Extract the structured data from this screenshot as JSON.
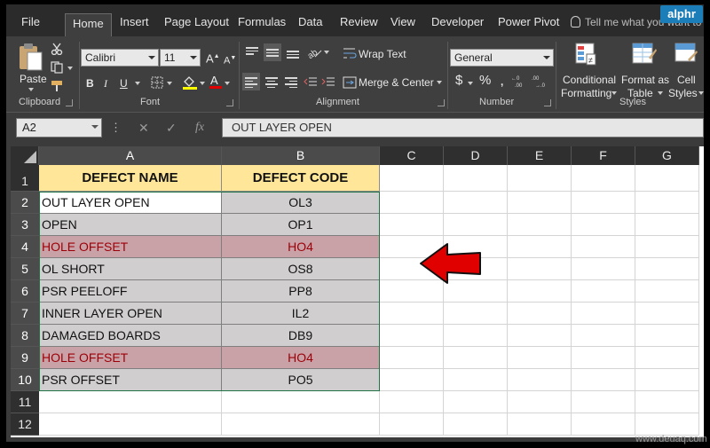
{
  "brand": "alphr",
  "tabs": [
    "File",
    "Home",
    "Insert",
    "Page Layout",
    "Formulas",
    "Data",
    "Review",
    "View",
    "Developer",
    "Power Pivot"
  ],
  "active_tab": "Home",
  "tell_me": "Tell me what you want to",
  "ribbon": {
    "clipboard": {
      "paste": "Paste",
      "label": "Clipboard"
    },
    "font": {
      "name": "Calibri",
      "size": "11",
      "bold": "B",
      "italic": "I",
      "underline": "U",
      "label": "Font"
    },
    "alignment": {
      "wrap_text": "Wrap Text",
      "merge_center": "Merge & Center",
      "label": "Alignment"
    },
    "number": {
      "format": "General",
      "currency": "$",
      "percent": "%",
      "label": "Number"
    },
    "styles": {
      "conditional_1": "Conditional",
      "conditional_2": "Formatting",
      "format_table_1": "Format as",
      "format_table_2": "Table",
      "cell_styles_1": "Cell",
      "cell_styles_2": "Styles",
      "label": "Styles"
    }
  },
  "formula_bar": {
    "name_box": "A2",
    "formula": "OUT LAYER OPEN",
    "fx": "fx"
  },
  "columns": [
    "A",
    "B",
    "C",
    "D",
    "E",
    "F",
    "G"
  ],
  "rows": [
    "1",
    "2",
    "3",
    "4",
    "5",
    "6",
    "7",
    "8",
    "9",
    "10",
    "11",
    "12"
  ],
  "table": {
    "headers": [
      "DEFECT NAME",
      "DEFECT CODE"
    ],
    "rows": [
      {
        "name": "OUT LAYER OPEN",
        "code": "OL3",
        "duplicate": false
      },
      {
        "name": "OPEN",
        "code": "OP1",
        "duplicate": false
      },
      {
        "name": "HOLE OFFSET",
        "code": "HO4",
        "duplicate": true
      },
      {
        "name": "OL SHORT",
        "code": "OS8",
        "duplicate": false
      },
      {
        "name": "PSR PEELOFF",
        "code": "PP8",
        "duplicate": false
      },
      {
        "name": "INNER LAYER OPEN",
        "code": "IL2",
        "duplicate": false
      },
      {
        "name": "DAMAGED BOARDS",
        "code": "DB9",
        "duplicate": false
      },
      {
        "name": "HOLE OFFSET",
        "code": "HO4",
        "duplicate": true
      },
      {
        "name": "PSR OFFSET",
        "code": "PO5",
        "duplicate": false
      }
    ]
  },
  "colors": {
    "header_fill": "#ffe699",
    "duplicate_fill": "#c9a2a8",
    "duplicate_text": "#9c0006",
    "range_fill": "#d0cece",
    "arrow": "#e00000",
    "selection": "#217346"
  },
  "icons": [
    "paste-icon",
    "cut-icon",
    "copy-icon",
    "format-painter-icon",
    "borders-icon",
    "fill-color-icon",
    "font-color-icon",
    "wrap-text-icon",
    "merge-icon",
    "conditional-formatting-icon",
    "format-table-icon",
    "cell-styles-icon",
    "red-arrow-icon"
  ],
  "watermark": "www.deuaq.com"
}
